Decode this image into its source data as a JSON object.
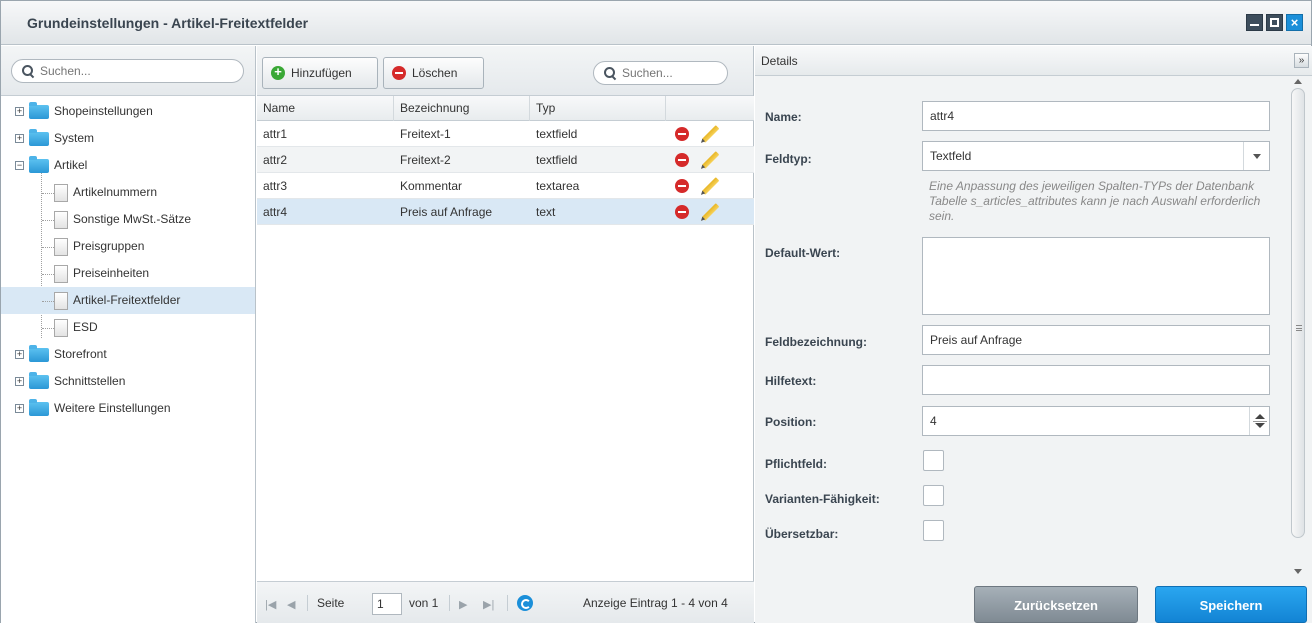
{
  "window": {
    "title": "Grundeinstellungen - Artikel-Freitextfelder"
  },
  "tree": {
    "search_placeholder": "Suchen...",
    "items": [
      {
        "label": "Shopeinstellungen",
        "type": "folder",
        "level": 0
      },
      {
        "label": "System",
        "type": "folder",
        "level": 0
      },
      {
        "label": "Artikel",
        "type": "folder",
        "level": 0,
        "expanded": true
      },
      {
        "label": "Artikelnummern",
        "type": "leaf",
        "level": 1
      },
      {
        "label": "Sonstige MwSt.-Sätze",
        "type": "leaf",
        "level": 1
      },
      {
        "label": "Preisgruppen",
        "type": "leaf",
        "level": 1
      },
      {
        "label": "Preiseinheiten",
        "type": "leaf",
        "level": 1
      },
      {
        "label": "Artikel-Freitextfelder",
        "type": "leaf",
        "level": 1,
        "selected": true
      },
      {
        "label": "ESD",
        "type": "leaf",
        "level": 1
      },
      {
        "label": "Storefront",
        "type": "folder",
        "level": 0
      },
      {
        "label": "Schnittstellen",
        "type": "folder",
        "level": 0
      },
      {
        "label": "Weitere Einstellungen",
        "type": "folder",
        "level": 0
      }
    ]
  },
  "grid": {
    "add_label": "Hinzufügen",
    "delete_label": "Löschen",
    "search_placeholder": "Suchen...",
    "columns": [
      "Name",
      "Bezeichnung",
      "Typ"
    ],
    "rows": [
      {
        "name": "attr1",
        "label": "Freitext-1",
        "type": "textfield"
      },
      {
        "name": "attr2",
        "label": "Freitext-2",
        "type": "textfield"
      },
      {
        "name": "attr3",
        "label": "Kommentar",
        "type": "textarea"
      },
      {
        "name": "attr4",
        "label": "Preis auf Anfrage",
        "type": "text"
      }
    ],
    "selected_row": 3,
    "pager": {
      "page_label": "Seite",
      "page": "1",
      "of_label": "von 1",
      "display": "Anzeige Eintrag 1 - 4 von 4"
    }
  },
  "details": {
    "title": "Details",
    "fields": {
      "name_label": "Name:",
      "name_value": "attr4",
      "fieldtype_label": "Feldtyp:",
      "fieldtype_value": "Textfeld",
      "fieldtype_help": "Eine Anpassung des jeweiligen Spalten-TYPs der Datenbank Tabelle s_articles_attributes kann je nach Auswahl erforderlich sein.",
      "default_label": "Default-Wert:",
      "default_value": "",
      "fieldlabel_label": "Feldbezeichnung:",
      "fieldlabel_value": "Preis auf Anfrage",
      "helptext_label": "Hilfetext:",
      "helptext_value": "",
      "position_label": "Position:",
      "position_value": "4",
      "required_label": "Pflichtfeld:",
      "variants_label": "Varianten-Fähigkeit:",
      "translatable_label": "Übersetzbar:"
    },
    "reset_label": "Zurücksetzen",
    "save_label": "Speichern"
  },
  "colors": {
    "accent": "#1b8fd9",
    "selection": "#d9e8f5",
    "delete": "#d52a2a",
    "add": "#3aa835"
  }
}
